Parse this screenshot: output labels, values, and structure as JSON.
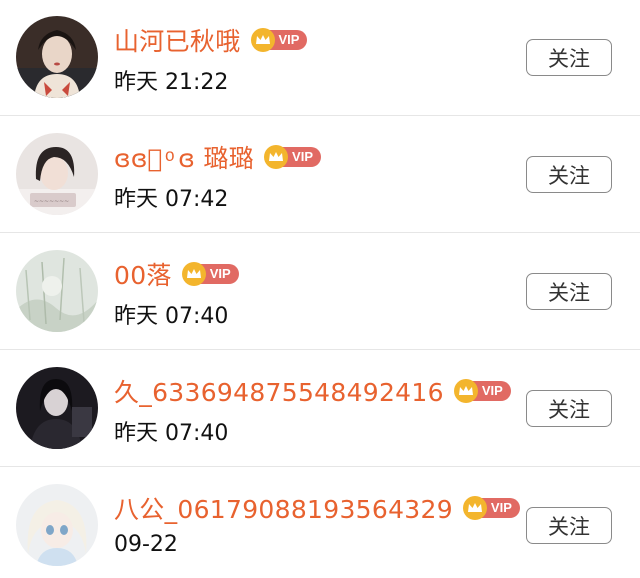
{
  "users": [
    {
      "name": "山河已秋哦",
      "badge": "VIP",
      "time": "昨天 21:22",
      "follow_label": "关注"
    },
    {
      "name": "ɞɞ⃞ ͦ ɞ 璐璐",
      "badge": "VIP",
      "time": "昨天 07:42",
      "follow_label": "关注"
    },
    {
      "name": "00落",
      "badge": "VIP",
      "time": "昨天 07:40",
      "follow_label": "关注"
    },
    {
      "name": "久_633694875548492416",
      "badge": "VIP",
      "time": "昨天 07:40",
      "follow_label": "关注"
    },
    {
      "name": "八公_06179088193564329",
      "badge": "VIP",
      "time": "09-22",
      "follow_label": "关注"
    }
  ],
  "colors": {
    "name": "#e8622f",
    "vip_badge": "#e16a63",
    "crown": "#f3b52d",
    "divider": "#e6e6e6"
  },
  "icons": {
    "vip": "crown-icon"
  }
}
